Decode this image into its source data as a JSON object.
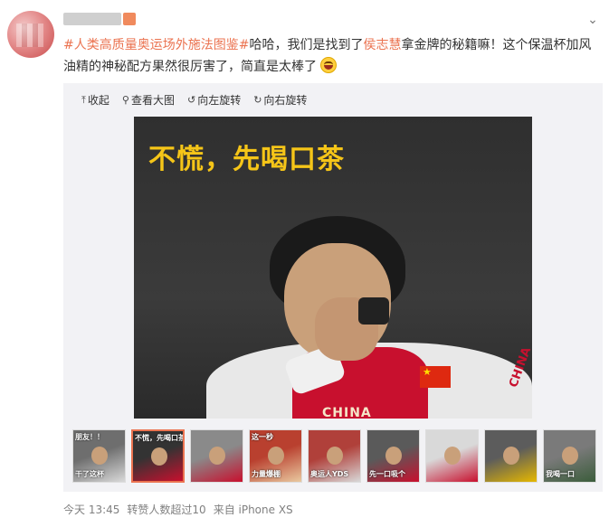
{
  "post": {
    "topic": "#人类高质量奥运场外施法图鉴#",
    "text_part1": "哈哈，我们是找到了",
    "mention": "侯志慧",
    "text_part2": "拿金牌的秘籍嘛！这个保温杯加风",
    "text_line2": "油精的神秘配方果然很厉害了，简直是太棒了",
    "emoji_icon": "laughing-emoji"
  },
  "toolbar": {
    "collapse": "收起",
    "view_large": "查看大图",
    "rotate_left": "向左旋转",
    "rotate_right": "向右旋转"
  },
  "main_image": {
    "caption": "不慌，先喝口茶",
    "sleeve_text": "CHINA",
    "vest_text": "CHINA"
  },
  "thumbnails": [
    {
      "label_top": "朋友！！",
      "label_bottom": "干了这杯",
      "colors": [
        "#6e6e6e",
        "#d9d9d9"
      ]
    },
    {
      "label_top": "不慌，先喝口茶",
      "label_bottom": "",
      "colors": [
        "#333333",
        "#c8102e"
      ],
      "active": true
    },
    {
      "label_top": "",
      "label_bottom": "",
      "colors": [
        "#8a8a8a",
        "#c8102e"
      ]
    },
    {
      "label_top": "这一秒",
      "label_bottom": "力量爆棚",
      "colors": [
        "#b9402f",
        "#e9c9a0"
      ]
    },
    {
      "label_top": "",
      "label_bottom": "奥运人YDS",
      "colors": [
        "#b0403a",
        "#d8d8d8"
      ]
    },
    {
      "label_top": "",
      "label_bottom": "先一口吸个",
      "colors": [
        "#5a5a5a",
        "#c8102e"
      ]
    },
    {
      "label_top": "",
      "label_bottom": "",
      "colors": [
        "#d9d9d9",
        "#c8102e"
      ]
    },
    {
      "label_top": "",
      "label_bottom": "",
      "colors": [
        "#5c5c5c",
        "#e6b800"
      ]
    },
    {
      "label_top": "",
      "label_bottom": "我喝一口",
      "colors": [
        "#7a7a7a",
        "#3b5d3b"
      ]
    }
  ],
  "footer": {
    "time": "今天 13:45",
    "reposts": "转赞人数超过10",
    "source": "来自 iPhone XS"
  }
}
